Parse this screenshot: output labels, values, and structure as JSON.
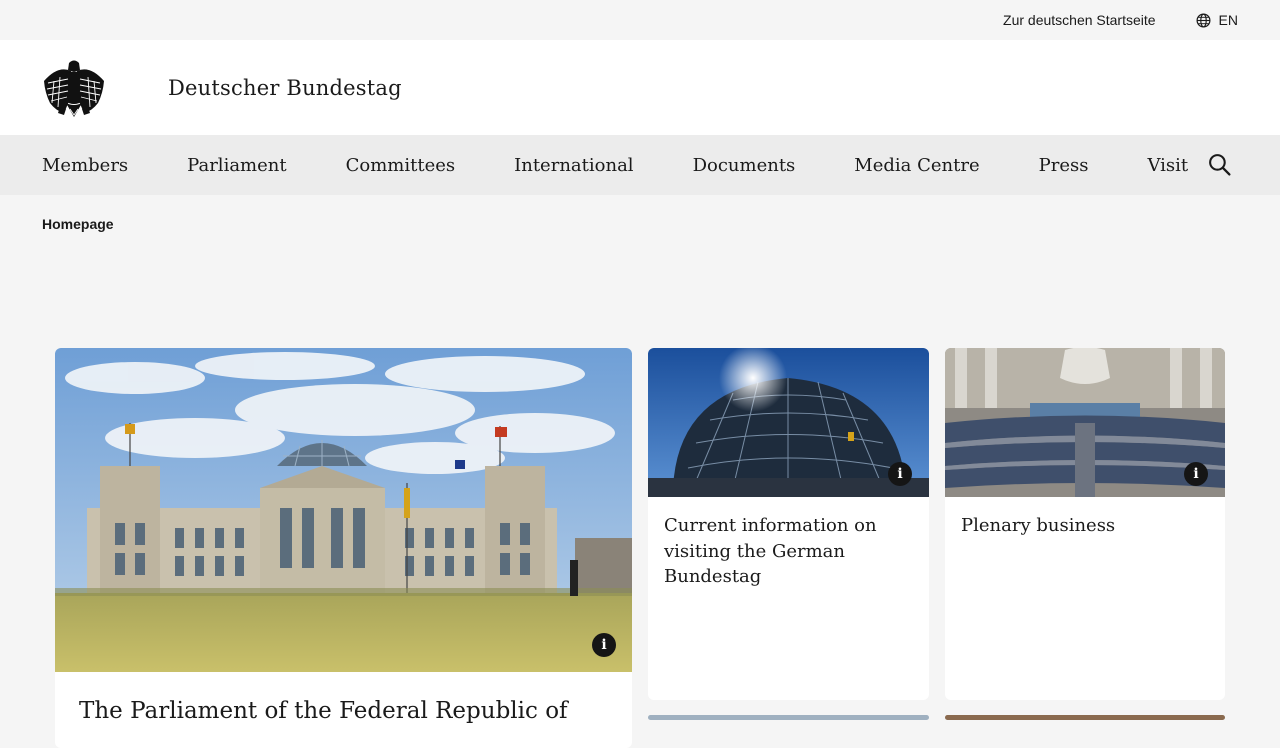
{
  "topbar": {
    "german_link": "Zur deutschen Startseite",
    "lang_label": "EN",
    "lang_icon": "globe-icon"
  },
  "header": {
    "title": "Deutscher Bundestag",
    "logo_icon": "federal-eagle-logo"
  },
  "nav": {
    "items": [
      "Members",
      "Parliament",
      "Committees",
      "International",
      "Documents",
      "Media Centre",
      "Press",
      "Visit"
    ],
    "search_icon": "search-icon"
  },
  "breadcrumb": {
    "current": "Homepage"
  },
  "cards": {
    "main": {
      "title": "The Parliament of the Federal Republic of",
      "image": "reichstag-building-photo"
    },
    "visit": {
      "title": "Current information on visiting the German Bundestag",
      "image": "reichstag-dome-photo"
    },
    "plenary": {
      "title": "Plenary business",
      "image": "plenary-chamber-photo"
    },
    "info_label": "i"
  },
  "colors": {
    "page_bg": "#f5f5f5",
    "nav_bg": "#ececec",
    "card_bg": "#ffffff",
    "text": "#1a1a1a"
  }
}
